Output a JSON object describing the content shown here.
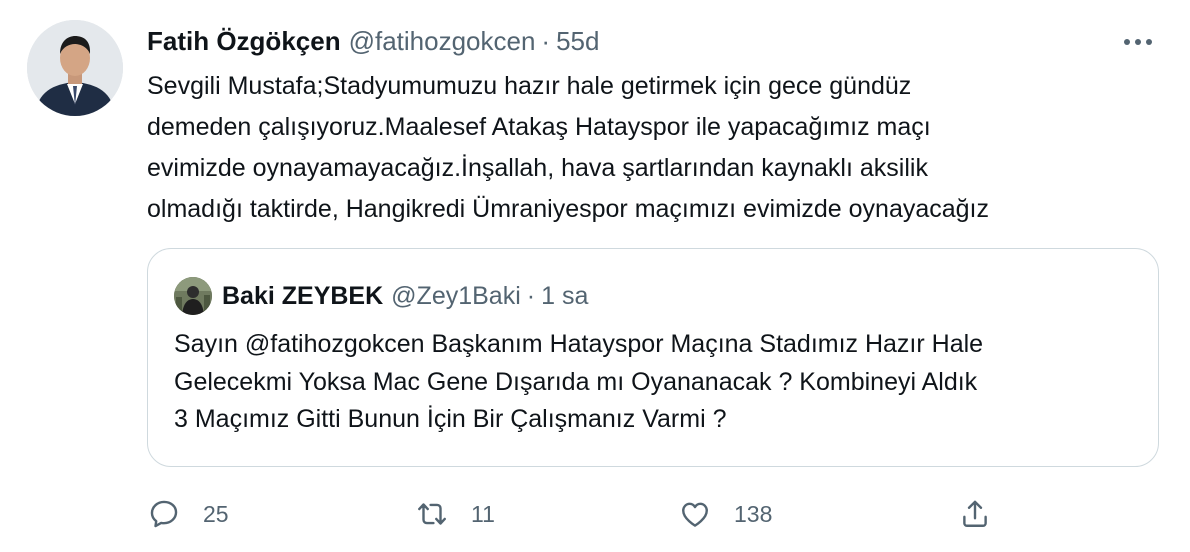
{
  "tweet": {
    "author": {
      "name": "Fatih Özgökçen",
      "handle": "@fatihozgokcen",
      "separator": "·",
      "time": "55d"
    },
    "text": "Sevgili Mustafa;Stadyumumuzu hazır hale getirmek için gece gündüz\ndemeden çalışıyoruz.Maalesef Atakaş Hatayspor ile yapacağımız maçı\nevimizde oynayamayacağız.İnşallah, hava şartlarından kaynaklı aksilik\nolmadığı taktirde, Hangikredi  Ümraniyespor  maçımızı evimizde oynayacağız",
    "more_icon": "more-horizontal-icon"
  },
  "quoted_tweet": {
    "author": {
      "name": "Baki ZEYBEK",
      "handle": "@Zey1Baki",
      "separator": "·",
      "time": "1 sa"
    },
    "text": "Sayın @fatihozgokcen Başkanım Hatayspor Maçına Stadımız Hazır Hale\nGelecekmi Yoksa Mac Gene Dışarıda mı Oyananacak ? Kombineyi Aldık\n3 Maçımız Gitti Bunun İçin Bir Çalışmanız Varmi ?"
  },
  "actions": {
    "reply": {
      "icon": "reply-icon",
      "count": "25"
    },
    "retweet": {
      "icon": "retweet-icon",
      "count": "11"
    },
    "like": {
      "icon": "heart-icon",
      "count": "138"
    },
    "share": {
      "icon": "share-icon"
    }
  },
  "colors": {
    "text": "#0f1419",
    "secondary": "#536471",
    "border": "#cfd9de"
  }
}
